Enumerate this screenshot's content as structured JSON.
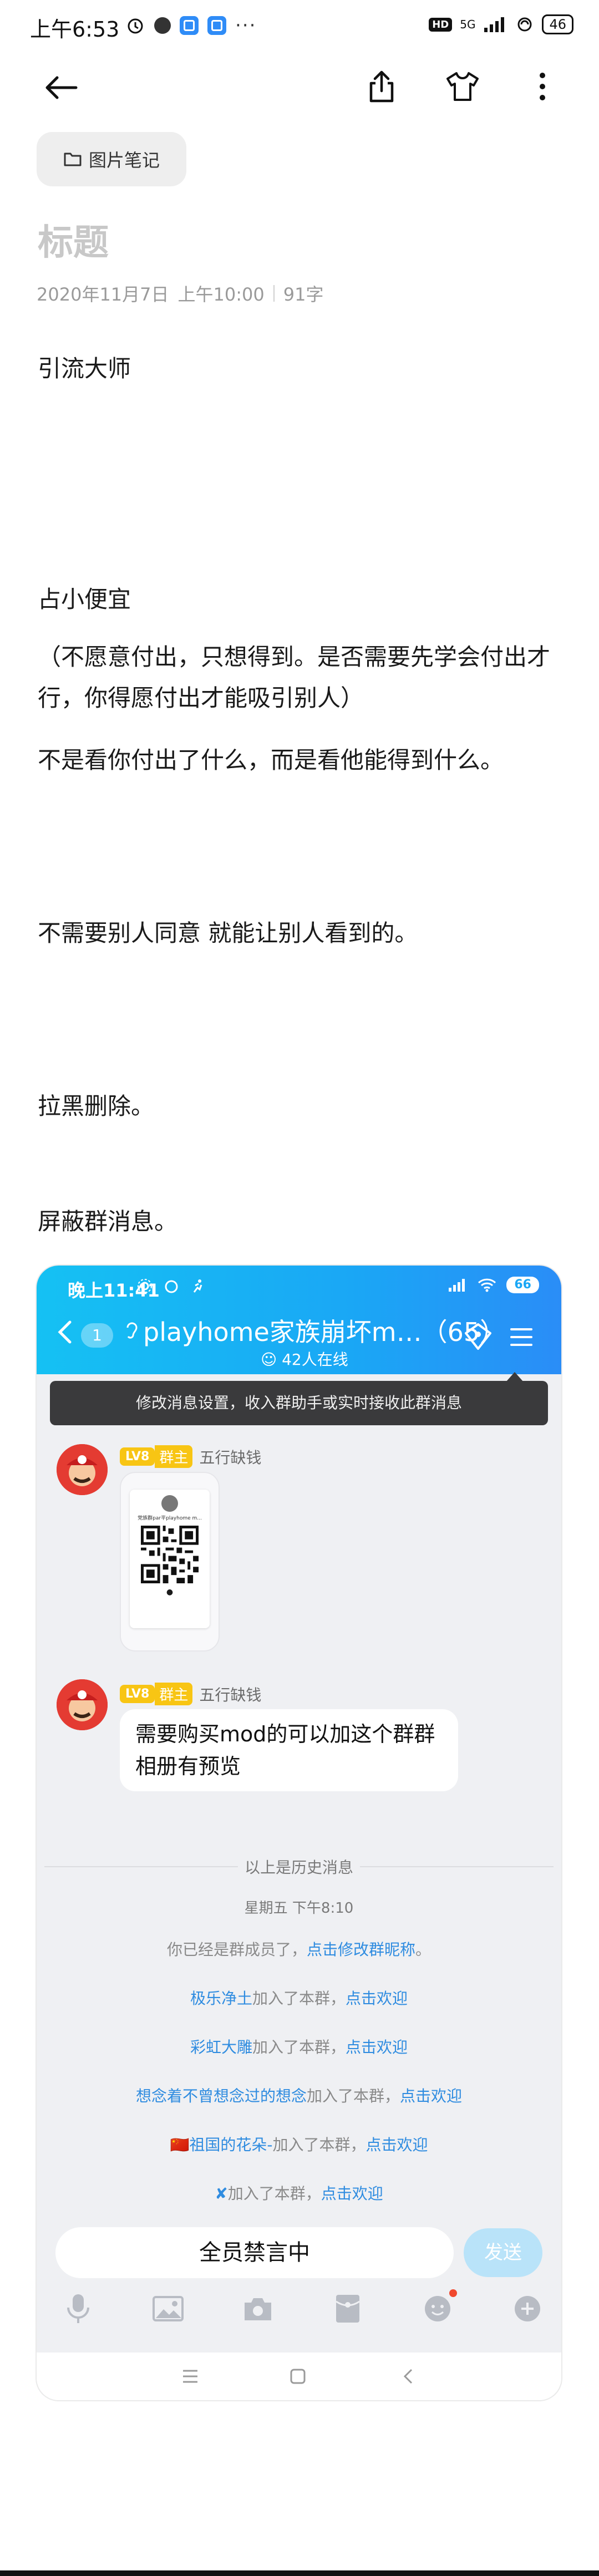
{
  "status_bar": {
    "time": "上午6:53",
    "more": "···",
    "hd": "HD",
    "network": "5G",
    "battery": "46"
  },
  "toolbar": {
    "back_icon": "arrow-left-icon",
    "share_icon": "share-icon",
    "theme_icon": "tshirt-icon",
    "more_icon": "more-vertical-icon"
  },
  "note": {
    "folder_label": "图片笔记",
    "title_placeholder": "标题",
    "date": "2020年11月7日",
    "time": "上午10:00",
    "word_count": "91字",
    "paragraphs": [
      "引流大师",
      "占小便宜",
      "（不愿意付出，只想得到。是否需要先学会付出才行，你得愿付出才能吸引别人）",
      "不是看你付出了什么，而是看他能得到什么。",
      "不需要别人同意  就能让别人看到的。",
      "拉黑删除。",
      "屏蔽群消息。"
    ]
  },
  "chat": {
    "time": "晚上11:41",
    "battery": "66",
    "unread_badge": "1",
    "group_title": "playhome家族崩坏m…（65）",
    "online": "42人在线",
    "tooltip": "修改消息设置，收入群助手或实时接收此群消息",
    "messages": [
      {
        "level": "LV8",
        "role": "群主",
        "nickname": "五行缺钱",
        "type": "image",
        "image_caption": "党族群par平playhome m..."
      },
      {
        "level": "LV8",
        "role": "群主",
        "nickname": "五行缺钱",
        "type": "text",
        "text": "需要购买mod的可以加这个群群相册有预览"
      }
    ],
    "history_note": "以上是历史消息",
    "date_note": "星期五 下午8:10",
    "member_note": {
      "prefix": "你已经是群成员了，",
      "link": "点击修改群昵称",
      "suffix": "。"
    },
    "joins": [
      {
        "name": "极乐净土",
        "mid": "加入了本群，",
        "link": "点击欢迎"
      },
      {
        "name": "彩虹大雕",
        "mid": "加入了本群，",
        "link": "点击欢迎"
      },
      {
        "name": "想念着不曾想念过的想念",
        "mid": "加入了本群，",
        "link": "点击欢迎"
      },
      {
        "name": "🇨🇳祖国的花朵-",
        "mid": "加入了本群，",
        "link": "点击欢迎"
      },
      {
        "name": "✘",
        "mid": "加入了本群，",
        "link": "点击欢迎"
      }
    ],
    "mute_text": "全员禁言中",
    "send_label": "发送"
  }
}
